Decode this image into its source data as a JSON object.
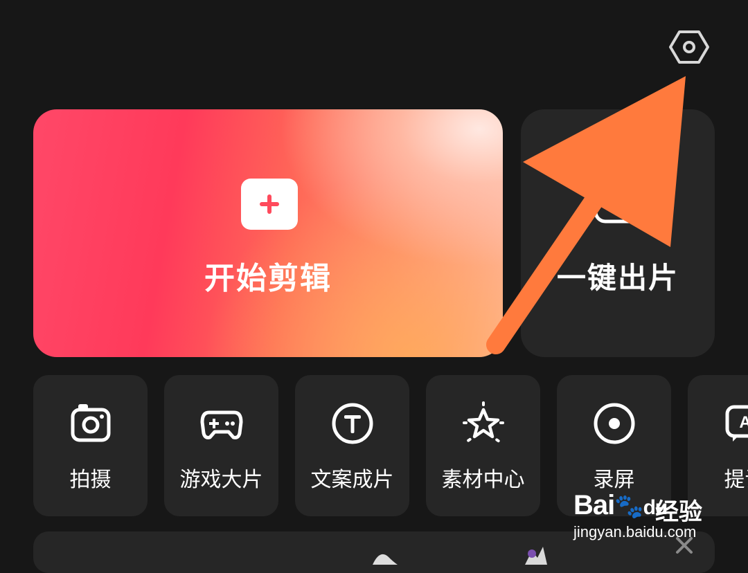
{
  "header": {
    "settings_icon": "hexagon-settings-icon"
  },
  "hero": {
    "label": "开始剪辑",
    "icon": "plus-icon",
    "accent": "#ff3a5a"
  },
  "oneclick": {
    "label": "一键出片",
    "icon": "lightning-icon"
  },
  "tools": [
    {
      "label": "拍摄",
      "icon": "camera-icon"
    },
    {
      "label": "游戏大片",
      "icon": "gamepad-icon"
    },
    {
      "label": "文案成片",
      "icon": "text-t-icon"
    },
    {
      "label": "素材中心",
      "icon": "sparkle-star-icon"
    },
    {
      "label": "录屏",
      "icon": "record-icon"
    },
    {
      "label": "提词",
      "icon": "teleprompter-icon"
    }
  ],
  "annotation": {
    "arrow_color": "#ff7a3d"
  },
  "watermark": {
    "brand": "Bai",
    "brand_suffix": "du",
    "brand_cn": "经验",
    "url": "jingyan.baidu.com"
  }
}
